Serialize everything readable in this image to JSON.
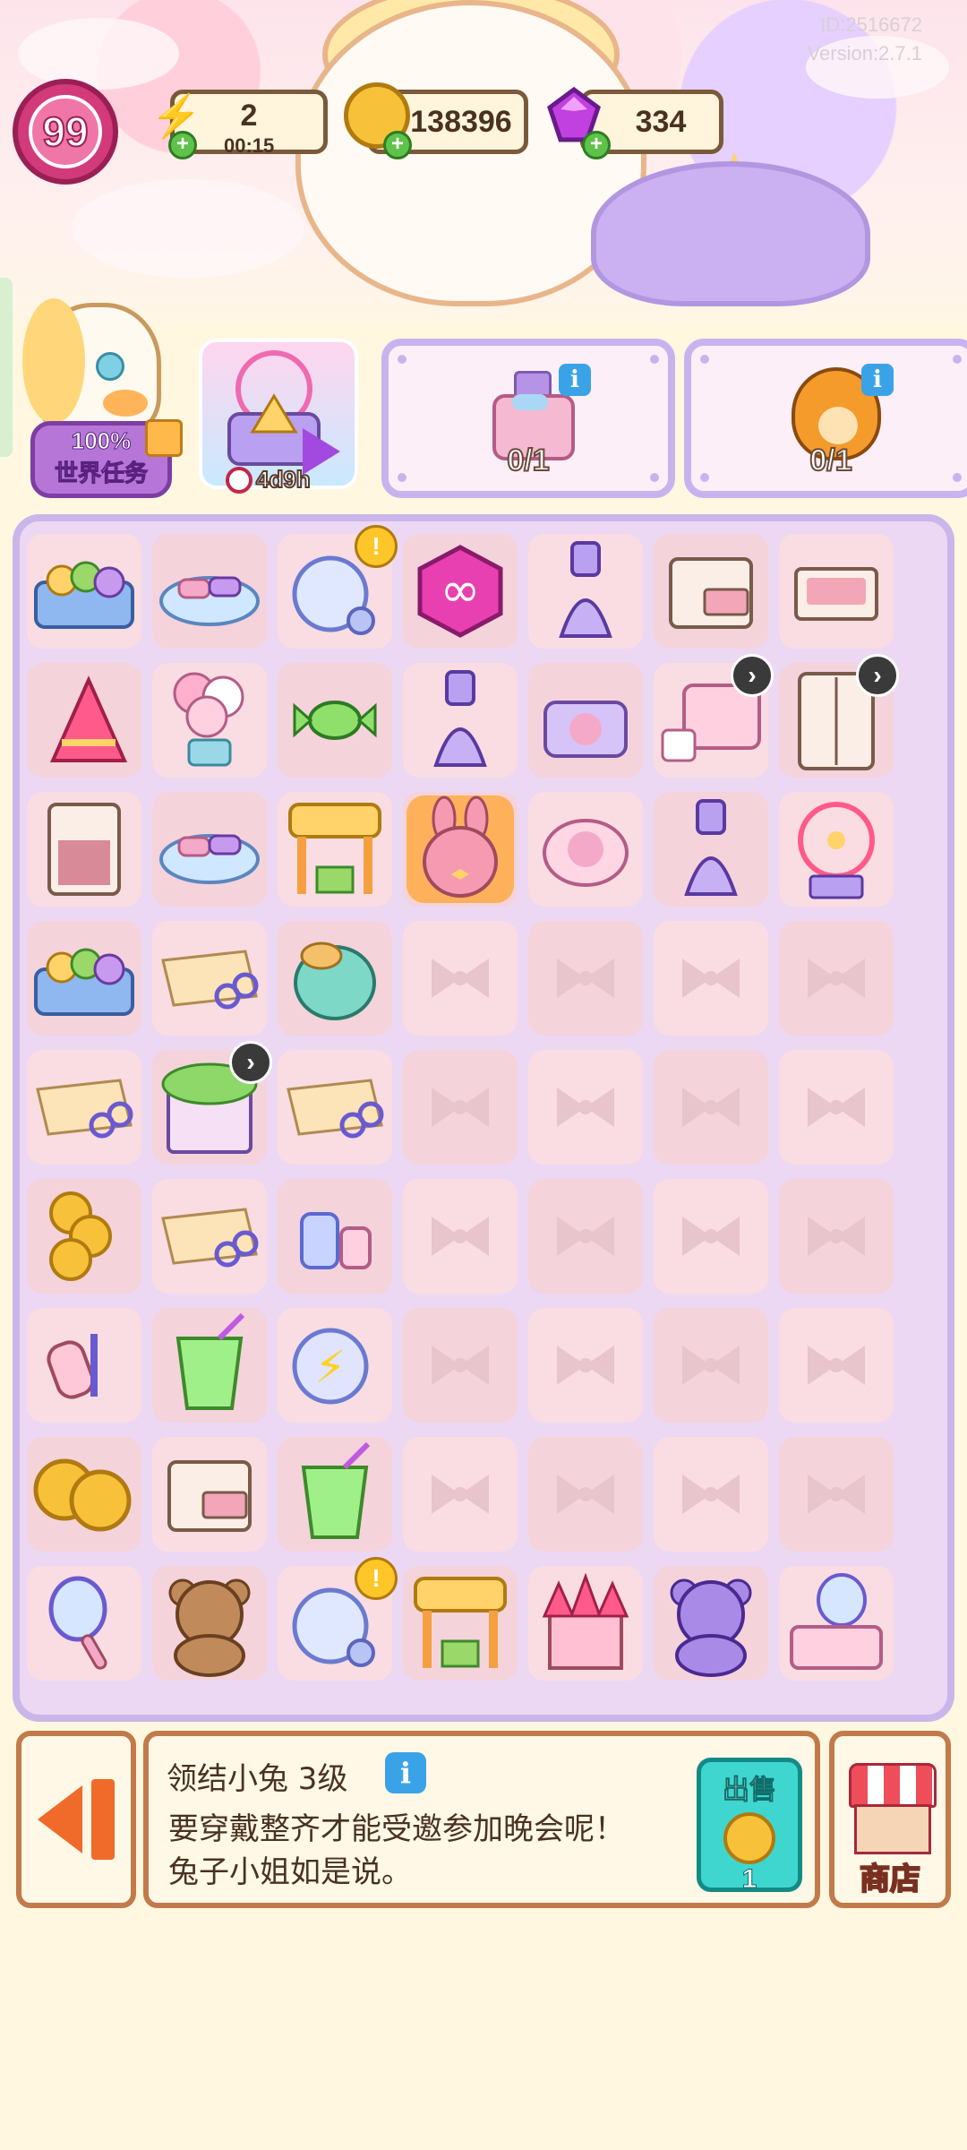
{
  "header": {
    "player_id": "ID:2516672",
    "version": "Version:2.7.1",
    "level": "99",
    "energy": {
      "value": "2",
      "timer": "00:15"
    },
    "coins": "138396",
    "gems": "334"
  },
  "tasks": {
    "world_task_percent": "100%",
    "world_task_label": "世界任务",
    "event_timer": "4d9h",
    "orders": [
      {
        "progress": "0/1",
        "icon": "perfume-bottle-icon"
      },
      {
        "progress": "0/1",
        "icon": "orange-tiger-plush-icon"
      }
    ],
    "info_glyph": "i"
  },
  "board": {
    "rows": [
      [
        "candy-box",
        "candy-plate",
        "glass-jar",
        "infinity-hexagon",
        "purple-dress",
        "drawer-cabinet",
        "open-drawer"
      ],
      [
        "party-hat",
        "balloon-bundle",
        "green-candy",
        "purple-dress",
        "makeup-compact",
        "pink-bedroom",
        "wardrobe"
      ],
      [
        "empty-cabinet",
        "candy-plate",
        "ticket-booth",
        "pink-bunny-plush",
        "macaron-box",
        "purple-dress",
        "ferris-wheel"
      ],
      [
        "candy-box",
        "paper-scissors",
        "teal-seal-plush",
        "",
        "",
        "",
        ""
      ],
      [
        "paper-scissors",
        "flower-shop",
        "paper-scissors",
        "",
        "",
        "",
        ""
      ],
      [
        "coin-stack",
        "paper-scissors",
        "lotion-bottles",
        "",
        "",
        "",
        ""
      ],
      [
        "lint-roller",
        "green-drink",
        "energy-jar",
        "",
        "",
        "",
        ""
      ],
      [
        "big-coins",
        "drawer-cabinet",
        "green-drink",
        "",
        "",
        "",
        ""
      ],
      [
        "hand-mirror",
        "brown-bear-plush",
        "glass-jar",
        "ticket-booth",
        "pink-castle",
        "purple-bear-plush",
        "vanity-table"
      ]
    ],
    "badges": {
      "exclaim": "!",
      "timer": "›"
    }
  },
  "bottom": {
    "item_title": "领结小兔 3级",
    "item_info": "i",
    "item_description": "要穿戴整齐才能受邀参加晚会呢！兔子小姐如是说。",
    "sell_label": "出售",
    "sell_price": "1",
    "shop_label": "商店"
  },
  "colors": {
    "board_border": "#cbb6ea",
    "cell_bg": "#f9dde2",
    "bar_border": "#c27a4a",
    "sell_button": "#3fd6cf"
  }
}
